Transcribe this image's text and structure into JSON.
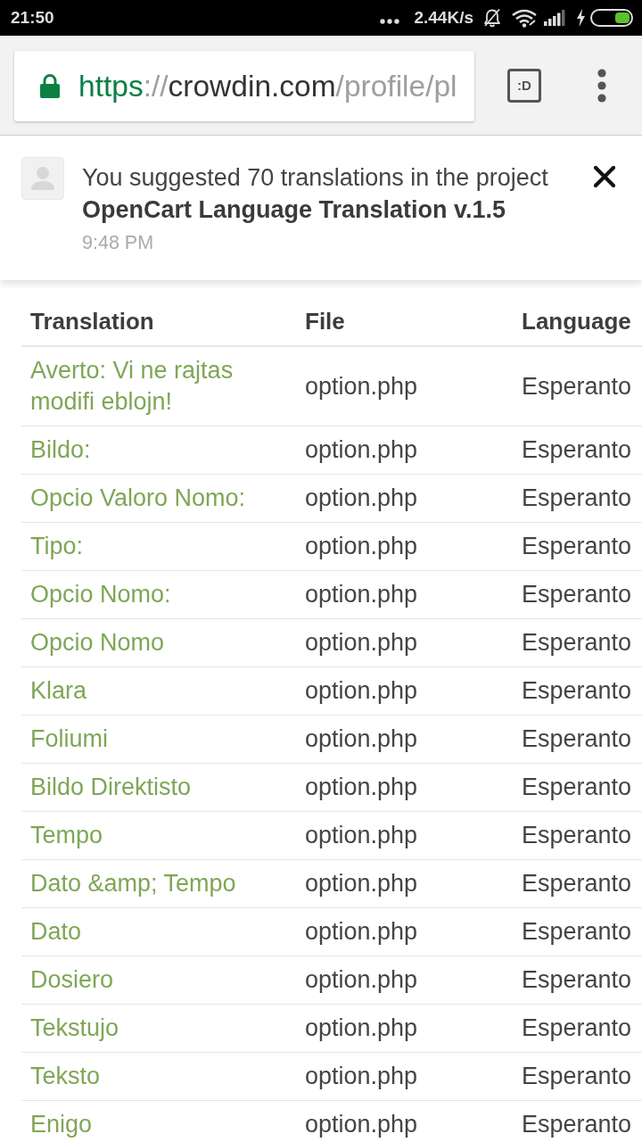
{
  "status_bar": {
    "time": "21:50",
    "network_speed": "2.44K/s"
  },
  "browser": {
    "url": [
      {
        "text": "https",
        "kind": "scheme"
      },
      {
        "text": "://",
        "kind": "separator"
      },
      {
        "text": "crowdin.com",
        "kind": "host"
      },
      {
        "text": "/profile/pl",
        "kind": "path"
      }
    ],
    "tab_switcher": ":D"
  },
  "notification": {
    "message": "You suggested 70 translations in the project **OpenCart Language Translation v.1.5**",
    "time": "9:48 PM"
  },
  "table": {
    "columns": [
      "Translation",
      "File",
      "Language"
    ],
    "rows": [
      {
        "translation": "Averto: Vi ne rajtas modifi eblojn!",
        "file": "option.php",
        "language": "Esperanto"
      },
      {
        "translation": "Bildo:",
        "file": "option.php",
        "language": "Esperanto"
      },
      {
        "translation": "Opcio Valoro Nomo:",
        "file": "option.php",
        "language": "Esperanto"
      },
      {
        "translation": "Tipo:",
        "file": "option.php",
        "language": "Esperanto"
      },
      {
        "translation": "Opcio Nomo:",
        "file": "option.php",
        "language": "Esperanto"
      },
      {
        "translation": "Opcio Nomo",
        "file": "option.php",
        "language": "Esperanto"
      },
      {
        "translation": "Klara",
        "file": "option.php",
        "language": "Esperanto"
      },
      {
        "translation": "Foliumi",
        "file": "option.php",
        "language": "Esperanto"
      },
      {
        "translation": "Bildo Direktisto",
        "file": "option.php",
        "language": "Esperanto"
      },
      {
        "translation": "Tempo",
        "file": "option.php",
        "language": "Esperanto"
      },
      {
        "translation": "Dato &amp; Tempo",
        "file": "option.php",
        "language": "Esperanto"
      },
      {
        "translation": "Dato",
        "file": "option.php",
        "language": "Esperanto"
      },
      {
        "translation": "Dosiero",
        "file": "option.php",
        "language": "Esperanto"
      },
      {
        "translation": "Tekstujo",
        "file": "option.php",
        "language": "Esperanto"
      },
      {
        "translation": "Teksto",
        "file": "option.php",
        "language": "Esperanto"
      },
      {
        "translation": "Enigo",
        "file": "option.php",
        "language": "Esperanto"
      }
    ]
  }
}
